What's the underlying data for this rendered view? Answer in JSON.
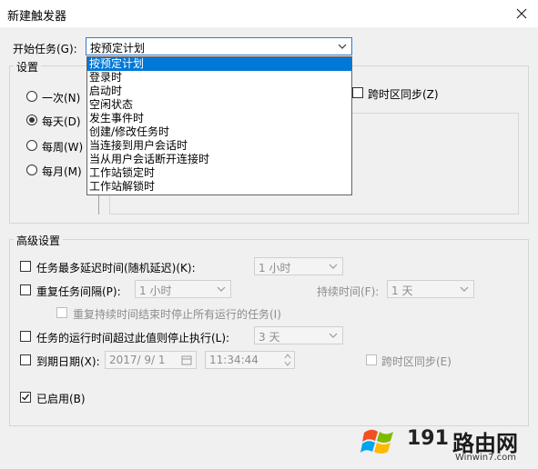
{
  "window": {
    "title": "新建触发器"
  },
  "start_task": {
    "label": "开始任务(G):",
    "selected": "按预定计划",
    "options": [
      "按预定计划",
      "登录时",
      "启动时",
      "空闲状态",
      "发生事件时",
      "创建/修改任务时",
      "当连接到用户会话时",
      "当从用户会话断开连接时",
      "工作站锁定时",
      "工作站解锁时"
    ]
  },
  "settings": {
    "label": "设置",
    "radios": [
      {
        "label": "一次(N)",
        "checked": false
      },
      {
        "label": "每天(D)",
        "checked": true
      },
      {
        "label": "每周(W)",
        "checked": false
      },
      {
        "label": "每月(M)",
        "checked": false
      }
    ],
    "sync_timezone": "跨时区同步(Z)"
  },
  "advanced": {
    "label": "高级设置",
    "max_delay": {
      "label": "任务最多延迟时间(随机延迟)(K):",
      "value": "1 小时"
    },
    "repeat": {
      "label": "重复任务间隔(P):",
      "value": "1 小时",
      "duration_label": "持续时间(F):",
      "duration_value": "1 天"
    },
    "stop_all": "重复持续时间结束时停止所有运行的任务(I)",
    "stop_if_longer": {
      "label": "任务的运行时间超过此值则停止执行(L):",
      "value": "3 天"
    },
    "expire": {
      "label": "到期日期(X):",
      "date": "2017/ 9/ 1",
      "time": "11:34:44",
      "sync": "跨时区同步(E)"
    },
    "enabled": {
      "label": "已启用(B)",
      "checked": true
    }
  },
  "watermark": {
    "text1": "191",
    "text2": "路由网",
    "url": "Winwin7.com"
  }
}
